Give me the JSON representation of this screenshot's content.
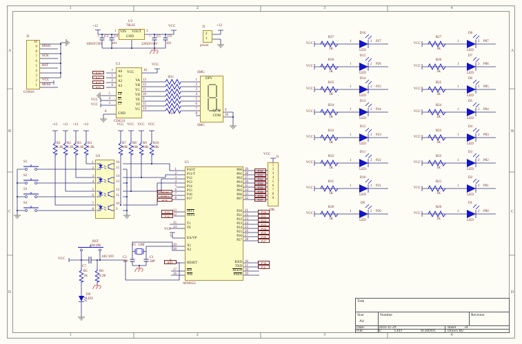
{
  "frame": {
    "zones_h": [
      "1",
      "2",
      "3",
      "4"
    ],
    "zones_v": [
      "A",
      "B",
      "C",
      "D"
    ]
  },
  "isp_header": {
    "ref": "J2",
    "part": "CON10",
    "rows": [
      {
        "pin": "10",
        "net": ""
      },
      {
        "pin": "9",
        "net": "MISO"
      },
      {
        "pin": "8",
        "net": ""
      },
      {
        "pin": "7",
        "net": "SCK"
      },
      {
        "pin": "6",
        "net": ""
      },
      {
        "pin": "5",
        "net": "RST"
      },
      {
        "pin": "4",
        "net": ""
      },
      {
        "pin": "3",
        "net": ""
      },
      {
        "pin": "2",
        "net": "VCC"
      },
      {
        "pin": "1",
        "net": "MOSI"
      }
    ]
  },
  "regulator": {
    "ref": "U3",
    "part": "78L05",
    "pin_in_name": "VIN",
    "pin_out_name": "VOUT",
    "pin_gnd_name": "GND",
    "pin_in": "1",
    "pin_out": "3",
    "rail_in": "+12",
    "rail_out": "VCC",
    "c3": {
      "pol": "+",
      "ref": "C3",
      "val": "100UF/50V"
    },
    "c4": {
      "ref": "C4",
      "val": "101"
    },
    "c5": {
      "pol": "+",
      "ref": "C5",
      "val": "220UF/50V"
    },
    "c6": {
      "ref": "C6",
      "val": "101"
    }
  },
  "power_conn": {
    "ref": "J3",
    "part": "power",
    "pin_top": "2",
    "pin_bot": "1",
    "rail": "+12"
  },
  "decoder": {
    "ref": "U2",
    "part": "CD4511",
    "rail": "VCC",
    "addr_pins": [
      {
        "name": "A0",
        "pin": "7",
        "port": "P30"
      },
      {
        "name": "A1",
        "pin": "1",
        "port": "P31"
      },
      {
        "name": "A2",
        "pin": "2",
        "port": "P32"
      },
      {
        "name": "A3",
        "pin": "6",
        "port": "P33"
      }
    ],
    "ctrl_pins": [
      {
        "name": "LE",
        "pin": "5",
        "rail": ""
      },
      {
        "name": "BI",
        "pin": "4",
        "rail": "VCC"
      },
      {
        "name": "LT",
        "pin": "3",
        "rail": "VCC"
      }
    ],
    "gnd_pin": {
      "name": "GND",
      "pin": "8"
    },
    "vcc_pin": {
      "name": "VCC",
      "pin": "16"
    },
    "seg_pins": [
      {
        "name": "YA",
        "pin": "13"
      },
      {
        "name": "YB",
        "pin": "12"
      },
      {
        "name": "YC",
        "pin": "11"
      },
      {
        "name": "YD",
        "pin": "10"
      },
      {
        "name": "YE",
        "pin": "9"
      },
      {
        "name": "YF",
        "pin": "15"
      },
      {
        "name": "YG",
        "pin": "14"
      }
    ]
  },
  "rnet_seg": {
    "ref": "R11",
    "val": "510"
  },
  "display": {
    "ref": "SMG",
    "ref2": "SMG",
    "part": "DPY",
    "pins_left": [
      "1",
      "2",
      "3",
      "4",
      "5",
      "6",
      "7",
      "8"
    ],
    "com_pins": [
      {
        "name": "COM",
        "pin": "9"
      },
      {
        "name": "COM",
        "pin": "10"
      }
    ]
  },
  "inputs": {
    "rails_12": [
      "+12",
      "+12",
      "+12",
      "+12"
    ],
    "rails_vcc": [
      "VCC",
      "VCC",
      "VCC",
      "VCC"
    ],
    "pull_12": [
      {
        "ref": "R1",
        "val": "3.3K"
      },
      {
        "ref": "R2",
        "val": "3.3K"
      },
      {
        "ref": "R3",
        "val": "3.3K"
      },
      {
        "ref": "R4",
        "val": "3.3K"
      }
    ],
    "pull_vcc": [
      {
        "ref": "R7",
        "val": "10K"
      },
      {
        "ref": "R8",
        "val": "10K"
      },
      {
        "ref": "R9",
        "val": "10K"
      },
      {
        "ref": "R10",
        "val": "10K"
      }
    ],
    "opto": {
      "ref": "U6",
      "pins_left": [
        "1",
        "2",
        "3",
        "4",
        "5",
        "6",
        "7",
        "8"
      ],
      "pins_right": [
        "16",
        "15",
        "14",
        "13",
        "12",
        "11",
        "10",
        "9"
      ]
    },
    "switches": [
      "S1",
      "S2",
      "S3",
      "S4"
    ]
  },
  "mcu": {
    "ref": "U1",
    "part": "AT89S52",
    "p1": [
      {
        "name": "P10/T",
        "pin": "1"
      },
      {
        "name": "P11/T",
        "pin": "2"
      },
      {
        "name": "P12",
        "pin": "3"
      },
      {
        "name": "P13",
        "pin": "4"
      },
      {
        "name": "P14",
        "pin": "5"
      },
      {
        "name": "P15",
        "pin": "6"
      },
      {
        "name": "P16",
        "pin": "7"
      },
      {
        "name": "P17",
        "pin": "8"
      }
    ],
    "isp_ports": [
      "MOSI",
      "MISO",
      "SCK"
    ],
    "ints": [
      {
        "name": "INT1",
        "pin": "13",
        "port": "P33"
      },
      {
        "name": "INT0",
        "pin": "12",
        "port": "P32"
      }
    ],
    "timers": [
      {
        "name": "T1",
        "pin": "15"
      },
      {
        "name": "T0",
        "pin": "14"
      }
    ],
    "ea": {
      "name": "EA/VP",
      "pin": "31",
      "rail": "VCC"
    },
    "xtal": [
      {
        "name": "X1",
        "pin": "19"
      },
      {
        "name": "X2",
        "pin": "18"
      }
    ],
    "reset": {
      "name": "RESET",
      "pin": "9",
      "port": "RST"
    },
    "rw": [
      {
        "name": "RD",
        "pin": "17"
      },
      {
        "name": "WR",
        "pin": "16"
      }
    ],
    "p0": [
      {
        "name": "P00",
        "pin": "39",
        "port": "P00"
      },
      {
        "name": "P01",
        "pin": "38",
        "port": "P01"
      },
      {
        "name": "P02",
        "pin": "37",
        "port": "P02"
      },
      {
        "name": "P03",
        "pin": "36",
        "port": "P03"
      },
      {
        "name": "P04",
        "pin": "35",
        "port": "P04"
      },
      {
        "name": "P05",
        "pin": "34",
        "port": "P05"
      },
      {
        "name": "P06",
        "pin": "33",
        "port": "P06"
      },
      {
        "name": "P07",
        "pin": "32",
        "port": "P07"
      }
    ],
    "p2": [
      {
        "name": "P20",
        "pin": "21",
        "port": "P20"
      },
      {
        "name": "P21",
        "pin": "22",
        "port": "P21"
      },
      {
        "name": "P22",
        "pin": "23",
        "port": "P22"
      },
      {
        "name": "P23",
        "pin": "24",
        "port": "P23"
      },
      {
        "name": "P24",
        "pin": "25",
        "port": "P24"
      },
      {
        "name": "P25",
        "pin": "26",
        "port": "P25"
      },
      {
        "name": "P26",
        "pin": "27",
        "port": "P26"
      },
      {
        "name": "P27",
        "pin": "28",
        "port": "P27"
      }
    ],
    "serial": [
      {
        "name": "RXD",
        "pin": "10",
        "port": "P30"
      },
      {
        "name": "TXD",
        "pin": "11",
        "port": "P31"
      }
    ],
    "ctrl": [
      {
        "name": "ALE/P",
        "pin": "30"
      },
      {
        "name": "PSEN",
        "pin": "29"
      }
    ]
  },
  "rnet_p0": {
    "ref": "J1",
    "val": "10K",
    "rail": "VCC",
    "pins": [
      "1",
      "2",
      "3",
      "4",
      "5",
      "6",
      "7",
      "8",
      "9"
    ]
  },
  "reset_ckt": {
    "ref_sw": "RST",
    "part_sw": "SW-PB",
    "rail": "VCC",
    "c_ref": "C7",
    "c_val": "10U/16V",
    "r1_ref": "R5",
    "r1_val": "1K",
    "r2_ref": "R6",
    "r2_val": "8.2K",
    "led_ref": "D0",
    "led_val": "LED"
  },
  "osc": {
    "ref": "Y1",
    "val": "12M",
    "c1_ref": "C1",
    "c1_val": "30P",
    "c2_ref": "C2",
    "c2_val": "30P"
  },
  "led_rail": "VCC",
  "led_bank_left": [
    {
      "res": "R37",
      "rval": "1K",
      "led": "D16",
      "lval": "LED",
      "p1": "1",
      "p2": "2",
      "net": "P27"
    },
    {
      "res": "R36",
      "rval": "1K",
      "led": "D15",
      "lval": "LED",
      "p1": "1",
      "p2": "2",
      "net": "P26"
    },
    {
      "res": "R35",
      "rval": "1K",
      "led": "D14",
      "lval": "LED",
      "p1": "1",
      "p2": "2",
      "net": "P25"
    },
    {
      "res": "R34",
      "rval": "1K",
      "led": "D13",
      "lval": "LED",
      "p1": "1",
      "p2": "2",
      "net": "P24"
    },
    {
      "res": "R33",
      "rval": "1K",
      "led": "D12",
      "lval": "LED",
      "p1": "1",
      "p2": "2",
      "net": "P23"
    },
    {
      "res": "R32",
      "rval": "1K",
      "led": "D11",
      "lval": "LED",
      "p1": "1",
      "p2": "2",
      "net": "P22"
    },
    {
      "res": "R31",
      "rval": "1K",
      "led": "D10",
      "lval": "LED",
      "p1": "1",
      "p2": "2",
      "net": "P21"
    },
    {
      "res": "R30",
      "rval": "1K",
      "led": "D9",
      "lval": "LED",
      "p1": "1",
      "p2": "2",
      "net": "P20"
    }
  ],
  "led_bank_right": [
    {
      "res": "R27",
      "rval": "1K",
      "led": "D8",
      "lval": "LED",
      "p1": "1",
      "p2": "2",
      "net": "P07"
    },
    {
      "res": "R26",
      "rval": "1K",
      "led": "D7",
      "lval": "LED",
      "p1": "1",
      "p2": "2",
      "net": "P06"
    },
    {
      "res": "R25",
      "rval": "1K",
      "led": "D6",
      "lval": "LED",
      "p1": "1",
      "p2": "2",
      "net": "P05"
    },
    {
      "res": "R24",
      "rval": "1K",
      "led": "D5",
      "lval": "LED",
      "p1": "1",
      "p2": "2",
      "net": "P04"
    },
    {
      "res": "R23",
      "rval": "1K",
      "led": "D4",
      "lval": "LED",
      "p1": "1",
      "p2": "2",
      "net": "P03"
    },
    {
      "res": "R22",
      "rval": "1K",
      "led": "D3",
      "lval": "LED",
      "p1": "1",
      "p2": "2",
      "net": "P02"
    },
    {
      "res": "R21",
      "rval": "1K",
      "led": "D2",
      "lval": "LED",
      "p1": "1",
      "p2": "2",
      "net": "P01"
    },
    {
      "res": "R20",
      "rval": "1K",
      "led": "D1",
      "lval": "LED",
      "p1": "1",
      "p2": "2",
      "net": "P00"
    }
  ],
  "title_block": {
    "title_label": "Title",
    "size_label": "Size",
    "size_value": "A4",
    "number_label": "Number",
    "revision_label": "Revision",
    "date_label": "Date:",
    "date_value": "2010-11-29",
    "sheet_label": "Sheet",
    "of_label": "of",
    "file_label": "File:",
    "file_drive": "E:",
    "file_name": "LED",
    "file_ext": "SCHDOC",
    "drawn_label": "Drawn By:"
  }
}
